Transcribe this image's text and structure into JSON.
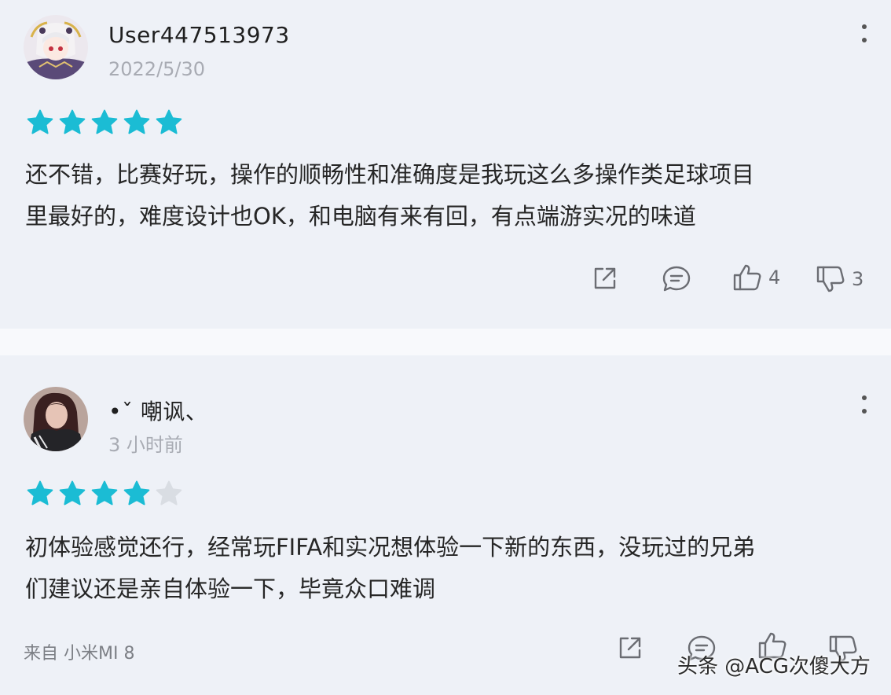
{
  "reviews": [
    {
      "username": "User447513973",
      "date": "2022/5/30",
      "rating": 5,
      "max_rating": 5,
      "text_line1": "还不错，比赛好玩，操作的顺畅性和准确度是我玩这么多操作类足球项目",
      "text_line2": "里最好的，难度设计也OK，和电脑有来有回，有点端游实况的味道",
      "likes": "4",
      "dislikes": "3"
    },
    {
      "username": "•ˇ 嘲讽、",
      "date": "3 小时前",
      "rating": 4,
      "max_rating": 5,
      "text_line1": "初体验感觉还行，经常玩FIFA和实况想体验一下新的东西，没玩过的兄弟",
      "text_line2": "们建议还是亲自体验一下，毕竟众口难调",
      "device": "来自 小米MI 8"
    }
  ],
  "watermark": "头条 @ACG次傻大方",
  "colors": {
    "star_filled": "#1bbcd4",
    "star_empty": "#d9dde3",
    "icon": "#6b6d73"
  },
  "icons": [
    "more-vertical-icon",
    "star-icon",
    "share-icon",
    "comment-icon",
    "thumbs-up-icon",
    "thumbs-down-icon"
  ]
}
